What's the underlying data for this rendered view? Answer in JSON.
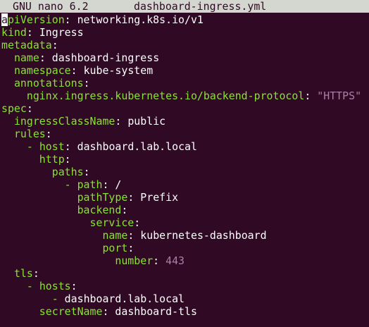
{
  "titlebar": {
    "app": "GNU nano 6.2",
    "filename": "dashboard-ingress.yml"
  },
  "lines": [
    [
      {
        "t": "apiVersion",
        "c": "k"
      },
      {
        "t": ": ",
        "c": "p"
      },
      {
        "t": "networking.k8s.io/v1",
        "c": "v"
      }
    ],
    [
      {
        "t": "kind",
        "c": "k"
      },
      {
        "t": ": ",
        "c": "p"
      },
      {
        "t": "Ingress",
        "c": "v"
      }
    ],
    [
      {
        "t": "metadata",
        "c": "k"
      },
      {
        "t": ":",
        "c": "p"
      }
    ],
    [
      {
        "t": "  "
      },
      {
        "t": "name",
        "c": "k"
      },
      {
        "t": ": ",
        "c": "p"
      },
      {
        "t": "dashboard-ingress",
        "c": "v"
      }
    ],
    [
      {
        "t": "  "
      },
      {
        "t": "namespace",
        "c": "k"
      },
      {
        "t": ": ",
        "c": "p"
      },
      {
        "t": "kube-system",
        "c": "v"
      }
    ],
    [
      {
        "t": "  "
      },
      {
        "t": "annotations",
        "c": "k"
      },
      {
        "t": ":",
        "c": "p"
      }
    ],
    [
      {
        "t": "    "
      },
      {
        "t": "nginx.ingress.kubernetes.io/backend-protocol",
        "c": "k"
      },
      {
        "t": ": ",
        "c": "p"
      },
      {
        "t": "\"HTTPS\"",
        "c": "s"
      }
    ],
    [
      {
        "t": "spec",
        "c": "k"
      },
      {
        "t": ":",
        "c": "p"
      }
    ],
    [
      {
        "t": "  "
      },
      {
        "t": "ingressClassName",
        "c": "k"
      },
      {
        "t": ": ",
        "c": "p"
      },
      {
        "t": "public",
        "c": "v"
      }
    ],
    [
      {
        "t": "  "
      },
      {
        "t": "rules",
        "c": "k"
      },
      {
        "t": ":",
        "c": "p"
      }
    ],
    [
      {
        "t": "    "
      },
      {
        "t": "- ",
        "c": "d"
      },
      {
        "t": "host",
        "c": "k"
      },
      {
        "t": ": ",
        "c": "p"
      },
      {
        "t": "dashboard.lab.local",
        "c": "v"
      }
    ],
    [
      {
        "t": "      "
      },
      {
        "t": "http",
        "c": "k"
      },
      {
        "t": ":",
        "c": "p"
      }
    ],
    [
      {
        "t": "        "
      },
      {
        "t": "paths",
        "c": "k"
      },
      {
        "t": ":",
        "c": "p"
      }
    ],
    [
      {
        "t": "          "
      },
      {
        "t": "- ",
        "c": "d"
      },
      {
        "t": "path",
        "c": "k"
      },
      {
        "t": ": ",
        "c": "p"
      },
      {
        "t": "/",
        "c": "v"
      }
    ],
    [
      {
        "t": "            "
      },
      {
        "t": "pathType",
        "c": "k"
      },
      {
        "t": ": ",
        "c": "p"
      },
      {
        "t": "Prefix",
        "c": "v"
      }
    ],
    [
      {
        "t": "            "
      },
      {
        "t": "backend",
        "c": "k"
      },
      {
        "t": ":",
        "c": "p"
      }
    ],
    [
      {
        "t": "              "
      },
      {
        "t": "service",
        "c": "k"
      },
      {
        "t": ":",
        "c": "p"
      }
    ],
    [
      {
        "t": "                "
      },
      {
        "t": "name",
        "c": "k"
      },
      {
        "t": ": ",
        "c": "p"
      },
      {
        "t": "kubernetes-dashboard",
        "c": "v"
      }
    ],
    [
      {
        "t": "                "
      },
      {
        "t": "port",
        "c": "k"
      },
      {
        "t": ":",
        "c": "p"
      }
    ],
    [
      {
        "t": "                  "
      },
      {
        "t": "number",
        "c": "k"
      },
      {
        "t": ": ",
        "c": "p"
      },
      {
        "t": "443",
        "c": "n"
      }
    ],
    [
      {
        "t": "  "
      },
      {
        "t": "tls",
        "c": "k"
      },
      {
        "t": ":",
        "c": "p"
      }
    ],
    [
      {
        "t": "    "
      },
      {
        "t": "- ",
        "c": "d"
      },
      {
        "t": "hosts",
        "c": "k"
      },
      {
        "t": ":",
        "c": "p"
      }
    ],
    [
      {
        "t": "        "
      },
      {
        "t": "- ",
        "c": "d"
      },
      {
        "t": "dashboard.lab.local",
        "c": "v"
      }
    ],
    [
      {
        "t": "      "
      },
      {
        "t": "secretName",
        "c": "k"
      },
      {
        "t": ": ",
        "c": "p"
      },
      {
        "t": "dashboard-tls",
        "c": "v"
      }
    ]
  ],
  "colors": {
    "background": "#300a24",
    "titlebar": "#d3d7cf",
    "key": "#8ae234",
    "text": "#ffffff",
    "string": "#ad7fa8"
  }
}
